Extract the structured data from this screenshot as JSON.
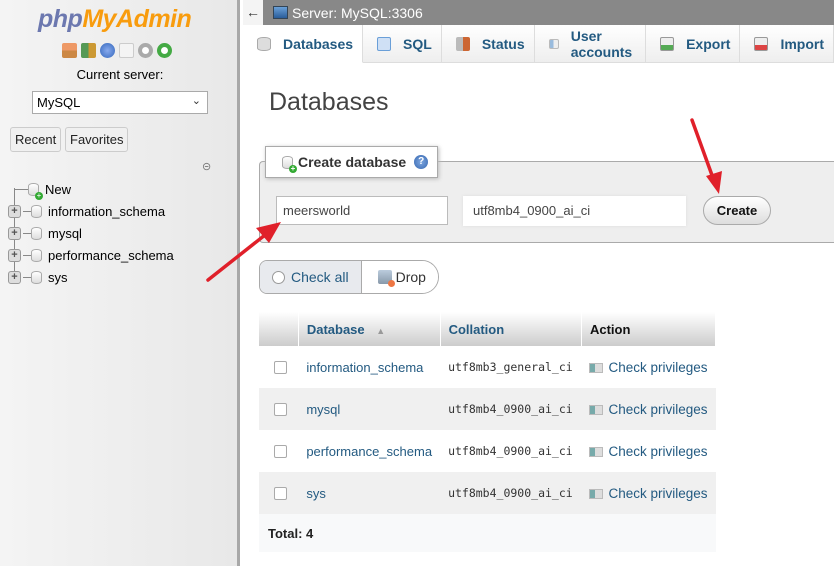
{
  "sidebar": {
    "logo_php": "php",
    "logo_myadmin": "MyAdmin",
    "current_server_label": "Current server:",
    "server_select_value": "MySQL",
    "recent_label": "Recent",
    "favorites_label": "Favorites",
    "tree": [
      {
        "label": "New",
        "type": "new"
      },
      {
        "label": "information_schema",
        "type": "db"
      },
      {
        "label": "mysql",
        "type": "db"
      },
      {
        "label": "performance_schema",
        "type": "db"
      },
      {
        "label": "sys",
        "type": "db"
      }
    ]
  },
  "topbar": {
    "back_label": "←",
    "title": "Server: MySQL:3306"
  },
  "tabs": [
    {
      "label": "Databases",
      "icon": "database-icon",
      "color": "#ddd"
    },
    {
      "label": "SQL",
      "icon": "sql-icon",
      "color": "#6a9fd8"
    },
    {
      "label": "Status",
      "icon": "status-icon",
      "color": "#c96"
    },
    {
      "label": "User accounts",
      "icon": "user-accounts-icon",
      "color": "#9bd"
    },
    {
      "label": "Export",
      "icon": "export-icon",
      "color": "#7b7"
    },
    {
      "label": "Import",
      "icon": "import-icon",
      "color": "#e66"
    }
  ],
  "page_title": "Databases",
  "create_db": {
    "legend": "Create database",
    "name_value": "meersworld",
    "collation_value": "utf8mb4_0900_ai_ci",
    "create_label": "Create"
  },
  "actions": {
    "check_all_label": "Check all",
    "drop_label": "Drop"
  },
  "table": {
    "headers": {
      "database": "Database",
      "sort_indicator": "▲",
      "collation": "Collation",
      "action": "Action"
    },
    "rows": [
      {
        "name": "information_schema",
        "collation": "utf8mb3_general_ci",
        "action": "Check privileges"
      },
      {
        "name": "mysql",
        "collation": "utf8mb4_0900_ai_ci",
        "action": "Check privileges"
      },
      {
        "name": "performance_schema",
        "collation": "utf8mb4_0900_ai_ci",
        "action": "Check privileges"
      },
      {
        "name": "sys",
        "collation": "utf8mb4_0900_ai_ci",
        "action": "Check privileges"
      }
    ],
    "total_label": "Total: 4"
  },
  "annotation_color": "#e0202a"
}
